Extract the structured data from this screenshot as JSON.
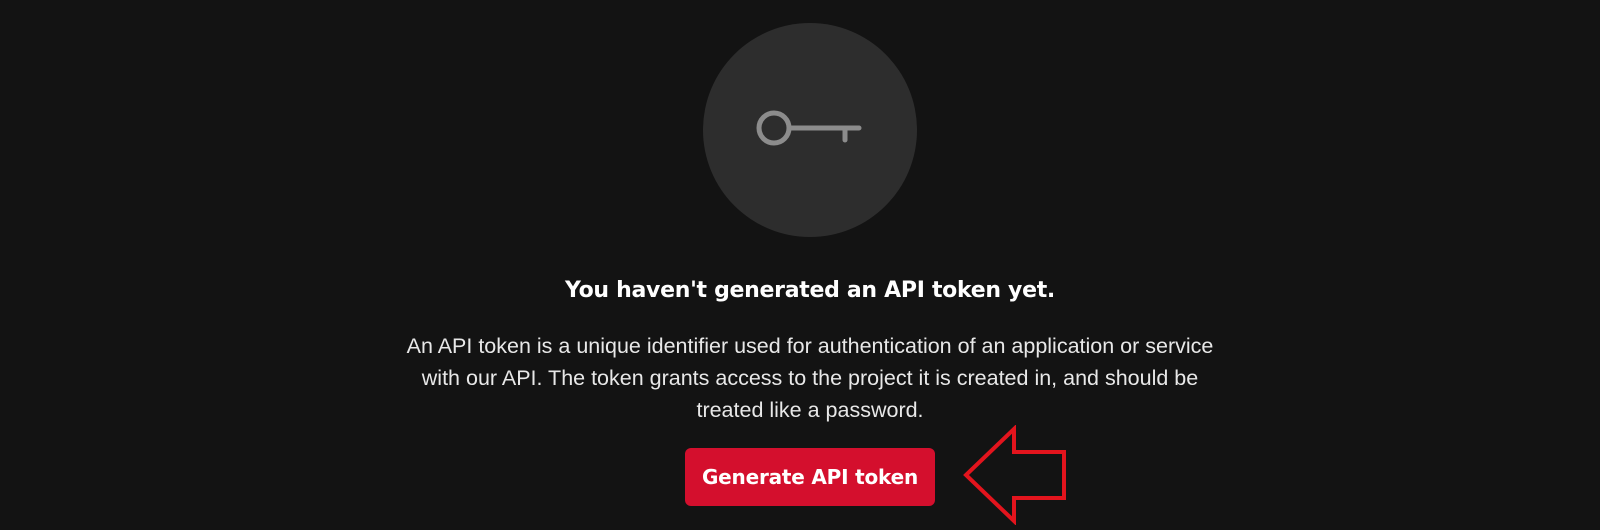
{
  "empty_state": {
    "icon": "key-icon",
    "heading": "You haven't generated an API token yet.",
    "description": "An API token is a unique identifier used for authentication of an application or service with our API. The token grants access to the project it is created in, and should be treated like a password.",
    "button_label": "Generate API token"
  },
  "annotation": {
    "icon": "arrow-left-outline-icon",
    "color": "#e3141d"
  },
  "colors": {
    "background": "#131313",
    "icon_circle": "#2d2d2d",
    "accent": "#d40f2d"
  }
}
